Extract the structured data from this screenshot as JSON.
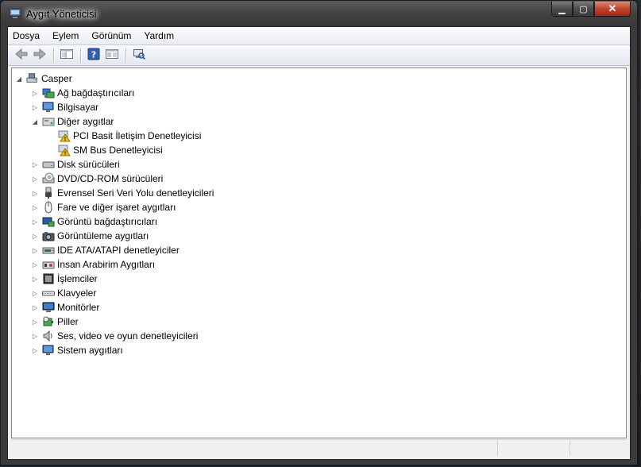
{
  "window": {
    "title": "Aygıt Yöneticisi"
  },
  "menu": [
    "Dosya",
    "Eylem",
    "Görünüm",
    "Yardım"
  ],
  "toolbar": [
    "back-icon",
    "forward-icon",
    "sep",
    "show-hide-console-tree-icon",
    "sep",
    "help-icon",
    "properties-icon",
    "sep",
    "scan-hardware-icon"
  ],
  "tree": {
    "root": "Casper",
    "children": [
      {
        "label": "Ağ bağdaştırıcıları",
        "icon": "network-adapter-icon",
        "expanded": false
      },
      {
        "label": "Bilgisayar",
        "icon": "computer-icon",
        "expanded": false
      },
      {
        "label": "Diğer aygıtlar",
        "icon": "other-devices-icon",
        "expanded": true,
        "children": [
          {
            "label": "PCI Basit İletişim Denetleyicisi",
            "icon": "warning-device-icon"
          },
          {
            "label": "SM Bus Denetleyicisi",
            "icon": "warning-device-icon"
          }
        ]
      },
      {
        "label": "Disk sürücüleri",
        "icon": "disk-drive-icon",
        "expanded": false
      },
      {
        "label": "DVD/CD-ROM sürücüleri",
        "icon": "dvd-drive-icon",
        "expanded": false
      },
      {
        "label": "Evrensel Seri Veri Yolu denetleyicileri",
        "icon": "usb-icon",
        "expanded": false
      },
      {
        "label": "Fare ve diğer işaret aygıtları",
        "icon": "mouse-icon",
        "expanded": false
      },
      {
        "label": "Görüntü bağdaştırıcıları",
        "icon": "display-adapter-icon",
        "expanded": false
      },
      {
        "label": "Görüntüleme aygıtları",
        "icon": "imaging-device-icon",
        "expanded": false
      },
      {
        "label": "IDE ATA/ATAPI denetleyiciler",
        "icon": "ide-controller-icon",
        "expanded": false
      },
      {
        "label": "İnsan Arabirim Aygıtları",
        "icon": "hid-icon",
        "expanded": false
      },
      {
        "label": "İşlemciler",
        "icon": "processor-icon",
        "expanded": false
      },
      {
        "label": "Klavyeler",
        "icon": "keyboard-icon",
        "expanded": false
      },
      {
        "label": "Monitörler",
        "icon": "monitor-icon",
        "expanded": false
      },
      {
        "label": "Piller",
        "icon": "battery-icon",
        "expanded": false
      },
      {
        "label": "Ses, video ve oyun denetleyicileri",
        "icon": "sound-icon",
        "expanded": false
      },
      {
        "label": "Sistem aygıtları",
        "icon": "system-device-icon",
        "expanded": false
      }
    ]
  },
  "colors": {
    "titlebar": "#3f3f3f",
    "close_button": "#c0462b",
    "tree_background": "#ffffff",
    "warning": "#f5c400"
  }
}
